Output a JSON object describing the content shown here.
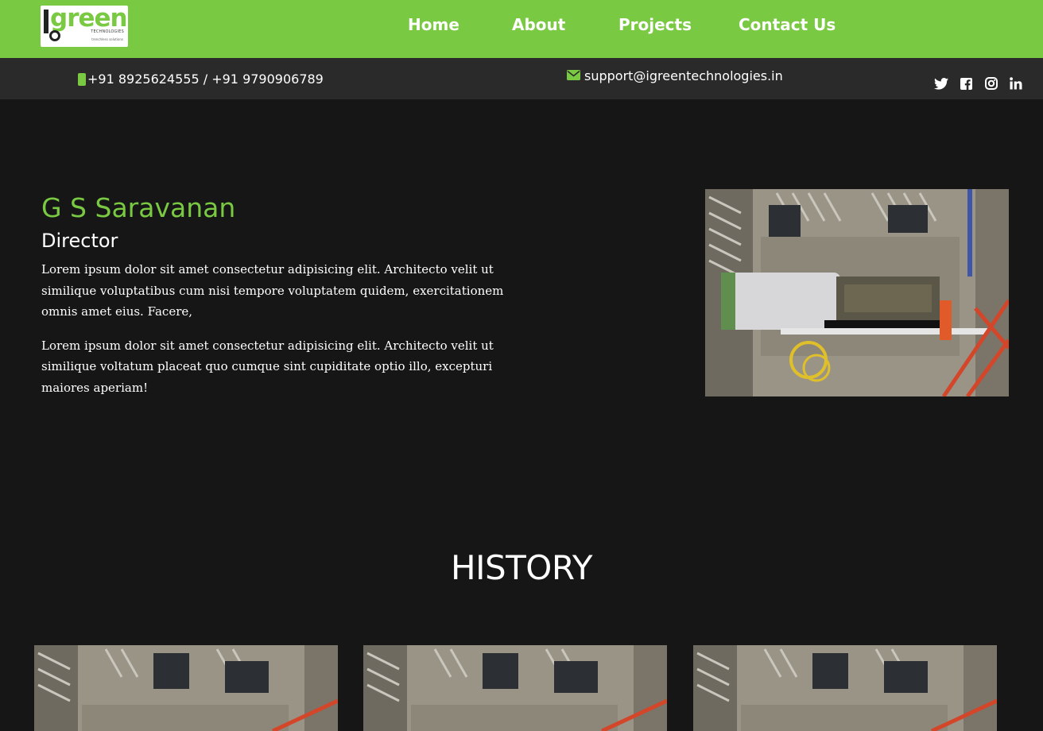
{
  "brand": {
    "logo_word": "green",
    "logo_sub": "TECHNOLOGIES",
    "logo_tag": "trenchless solutions"
  },
  "nav": {
    "home": "Home",
    "about": "About",
    "projects": "Projects",
    "contact": "Contact Us"
  },
  "contact_bar": {
    "phone_icon": "mobile-phone-icon",
    "phone": "+91 8925624555 / +91 9790906789",
    "email_icon": "envelope-icon",
    "email": "support@igreentechnologies.in",
    "social": [
      "twitter-icon",
      "facebook-icon",
      "instagram-icon",
      "linkedin-icon"
    ]
  },
  "director": {
    "name": "G S Saravanan",
    "role": "Director",
    "para1": "Lorem ipsum dolor sit amet consectetur adipisicing elit. Architecto velit ut similique voluptatibus cum nisi tempore voluptatem quidem, exercitationem omnis amet eius. Facere,",
    "para2": "Lorem ipsum dolor sit amet consectetur adipisicing elit. Architecto velit ut similique voltatum placeat quo cumque sint cupiditate optio illo, excepturi maiores aperiam!"
  },
  "history": {
    "title": "HISTORY"
  },
  "colors": {
    "brand_green": "#7ac943",
    "page_bg": "#161616",
    "contact_bar_bg": "#2b2a2a"
  }
}
